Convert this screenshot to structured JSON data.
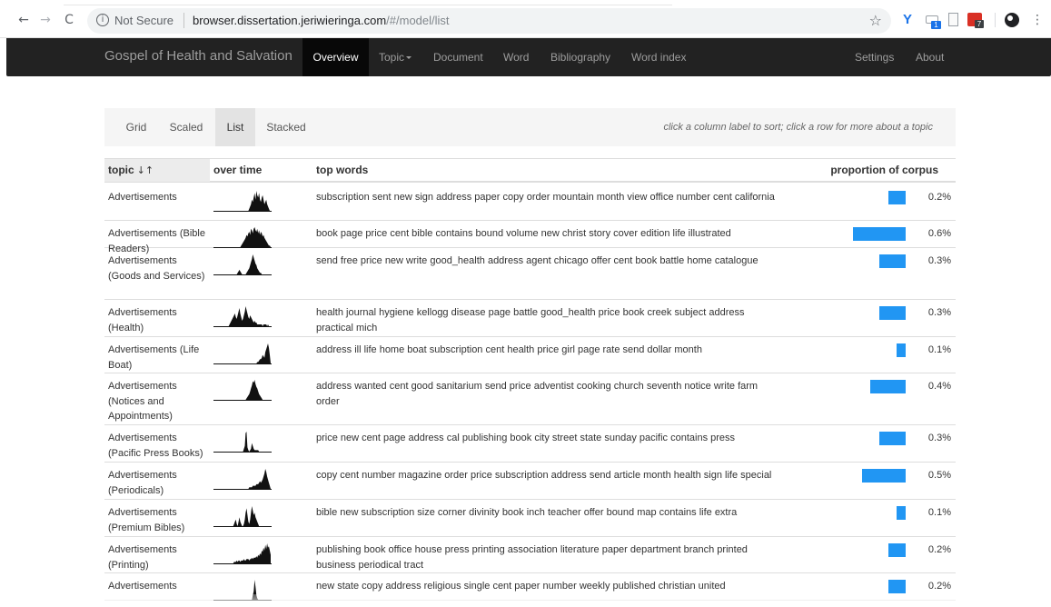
{
  "browser": {
    "back": "←",
    "forward": "→",
    "reload": "C",
    "security": "Not Secure",
    "url_host": "browser.dissertation.jeriwieringa.com",
    "url_path": "/#/model/list",
    "bookmark": "☆",
    "ext_tab_badge": "1",
    "ext_red_badge": "7",
    "menu": "⋮"
  },
  "nav": {
    "brand": "Gospel of Health and Salvation",
    "items": [
      "Overview",
      "Topic",
      "Document",
      "Word",
      "Bibliography",
      "Word index"
    ],
    "right": [
      "Settings",
      "About"
    ]
  },
  "subnav": {
    "pills": [
      "Grid",
      "Scaled",
      "List",
      "Stacked"
    ],
    "active": "List",
    "hint": "click a column label to sort; click a row for more about a topic"
  },
  "table": {
    "headers": [
      "topic",
      "over time",
      "top words",
      "proportion of corpus"
    ],
    "sort_icon": "↓↑",
    "rows": [
      {
        "topic": "Advertisements",
        "words": "subscription sent new sign address paper copy order mountain month view office number cent california",
        "pct": "0.2%",
        "prop": 0.2,
        "spark": [
          0,
          0,
          0,
          0,
          0,
          0,
          0,
          0,
          0,
          0,
          0,
          0,
          0,
          0,
          0,
          0,
          0,
          0,
          0,
          0,
          0,
          0,
          0,
          0,
          0,
          0,
          0,
          0,
          0,
          0,
          0,
          0,
          0,
          0,
          0,
          0,
          0,
          0,
          0,
          1,
          2,
          3,
          5,
          4,
          6,
          8,
          5,
          9,
          7,
          6,
          8,
          5,
          4,
          6,
          7,
          5,
          3,
          4,
          5,
          3,
          2,
          1,
          0,
          0
        ]
      },
      {
        "topic": "Advertisements (Bible Readers)",
        "words": "book page price cent bible contains bound volume new christ story cover edition life illustrated",
        "pct": "0.6%",
        "prop": 0.6,
        "spark": [
          0,
          0,
          0,
          0,
          0,
          0,
          0,
          0,
          0,
          0,
          0,
          0,
          0,
          0,
          0,
          0,
          0,
          0,
          0,
          0,
          0,
          0,
          0,
          0,
          0,
          0,
          0,
          0,
          0,
          0,
          1,
          2,
          3,
          4,
          5,
          6,
          8,
          7,
          9,
          10,
          8,
          12,
          11,
          9,
          12,
          13,
          11,
          10,
          12,
          9,
          11,
          8,
          10,
          9,
          7,
          8,
          6,
          5,
          4,
          3,
          2,
          1,
          1,
          0
        ]
      },
      {
        "topic": "Advertisements (Goods and Services)",
        "words": "send free price new write good_health address agent chicago offer cent book battle home catalogue",
        "pct": "0.3%",
        "prop": 0.3,
        "spark": [
          0,
          0,
          0,
          0,
          0,
          0,
          0,
          0,
          0,
          0,
          0,
          0,
          0,
          0,
          0,
          0,
          0,
          0,
          0,
          0,
          0,
          0,
          0,
          0,
          0,
          0,
          1,
          2,
          3,
          2,
          1,
          0,
          0,
          0,
          0,
          0,
          1,
          2,
          3,
          4,
          6,
          8,
          10,
          13,
          11,
          9,
          7,
          6,
          4,
          3,
          2,
          1,
          1,
          0,
          0,
          0,
          0,
          0,
          0,
          0,
          0,
          0,
          0,
          0
        ]
      },
      {
        "topic": "Advertisements (Health)",
        "words": "health journal hygiene kellogg disease page battle good_health price book creek subject address practical mich",
        "pct": "0.3%",
        "prop": 0.3,
        "spark": [
          0,
          0,
          0,
          0,
          0,
          0,
          0,
          0,
          0,
          0,
          0,
          0,
          0,
          0,
          0,
          0,
          0,
          1,
          2,
          3,
          4,
          5,
          6,
          7,
          5,
          4,
          6,
          8,
          10,
          7,
          5,
          3,
          4,
          6,
          8,
          11,
          9,
          7,
          5,
          4,
          6,
          5,
          4,
          3,
          2,
          3,
          2,
          2,
          1,
          1,
          1,
          1,
          1,
          1,
          0,
          1,
          1,
          1,
          1,
          0,
          1,
          0,
          0,
          0
        ]
      },
      {
        "topic": "Advertisements (Life Boat)",
        "words": "address ill life home boat subscription cent health price girl page rate send dollar month",
        "pct": "0.1%",
        "prop": 0.1,
        "spark": [
          0,
          0,
          0,
          0,
          0,
          0,
          0,
          0,
          0,
          0,
          0,
          0,
          0,
          0,
          0,
          0,
          0,
          0,
          0,
          0,
          0,
          0,
          0,
          0,
          0,
          0,
          0,
          0,
          0,
          0,
          0,
          0,
          0,
          0,
          0,
          0,
          0,
          0,
          0,
          0,
          0,
          0,
          0,
          0,
          0,
          0,
          0,
          0,
          1,
          1,
          2,
          3,
          3,
          4,
          6,
          5,
          4,
          8,
          10,
          12,
          14,
          11,
          6,
          0
        ]
      },
      {
        "topic": "Advertisements (Notices and Appointments)",
        "words": "address wanted cent good sanitarium send price adventist cooking church seventh notice write farm order",
        "pct": "0.4%",
        "prop": 0.4,
        "spark": [
          0,
          0,
          0,
          0,
          0,
          0,
          0,
          0,
          0,
          0,
          0,
          0,
          0,
          0,
          0,
          0,
          0,
          0,
          0,
          0,
          0,
          0,
          0,
          0,
          0,
          0,
          0,
          0,
          0,
          0,
          0,
          0,
          0,
          0,
          0,
          0,
          1,
          2,
          3,
          4,
          6,
          8,
          10,
          13,
          12,
          14,
          11,
          9,
          8,
          6,
          4,
          3,
          2,
          1,
          0,
          0,
          0,
          0,
          0,
          0,
          0,
          0,
          0,
          0
        ]
      },
      {
        "topic": "Advertisements (Pacific Press Books)",
        "words": "price new cent page address cal publishing book city street state sunday pacific contains press",
        "pct": "0.3%",
        "prop": 0.3,
        "spark": [
          0,
          0,
          0,
          0,
          0,
          0,
          0,
          0,
          0,
          0,
          0,
          0,
          0,
          0,
          0,
          0,
          0,
          0,
          0,
          0,
          0,
          0,
          0,
          0,
          0,
          0,
          0,
          0,
          0,
          0,
          0,
          0,
          0,
          2,
          4,
          13,
          14,
          3,
          1,
          0,
          1,
          2,
          6,
          4,
          2,
          1,
          1,
          1,
          1,
          1,
          0,
          0,
          0,
          0,
          0,
          0,
          0,
          0,
          0,
          0,
          0,
          0,
          0,
          0
        ]
      },
      {
        "topic": "Advertisements (Periodicals)",
        "words": "copy cent number magazine order price subscription address send article month health sign life special",
        "pct": "0.5%",
        "prop": 0.5,
        "spark": [
          0,
          0,
          0,
          0,
          0,
          0,
          0,
          0,
          0,
          0,
          0,
          0,
          0,
          0,
          0,
          0,
          0,
          0,
          0,
          0,
          0,
          0,
          0,
          0,
          0,
          0,
          0,
          0,
          0,
          0,
          0,
          0,
          0,
          0,
          0,
          0,
          0,
          0,
          0,
          1,
          1,
          1,
          1,
          2,
          2,
          2,
          2,
          3,
          3,
          3,
          4,
          5,
          4,
          5,
          6,
          8,
          10,
          13,
          11,
          8,
          6,
          4,
          2,
          0
        ]
      },
      {
        "topic": "Advertisements (Premium Bibles)",
        "words": "bible new subscription size corner divinity book inch teacher offer bound map contains life extra",
        "pct": "0.1%",
        "prop": 0.1,
        "spark": [
          0,
          0,
          0,
          0,
          0,
          0,
          0,
          0,
          0,
          0,
          0,
          0,
          0,
          0,
          0,
          0,
          0,
          0,
          0,
          0,
          0,
          0,
          1,
          2,
          3,
          1,
          0,
          2,
          4,
          2,
          1,
          0,
          0,
          1,
          3,
          6,
          8,
          5,
          2,
          1,
          3,
          6,
          9,
          7,
          5,
          6,
          4,
          3,
          2,
          1,
          0,
          0,
          0,
          0,
          0,
          0,
          0,
          0,
          0,
          0,
          0,
          0,
          0,
          0
        ]
      },
      {
        "topic": "Advertisements (Printing)",
        "words": "publishing book office house press printing association literature paper department branch printed business periodical tract",
        "pct": "0.2%",
        "prop": 0.2,
        "spark": [
          0,
          0,
          0,
          0,
          0,
          0,
          0,
          0,
          0,
          0,
          0,
          0,
          0,
          0,
          0,
          0,
          0,
          0,
          0,
          0,
          0,
          0,
          1,
          1,
          1,
          2,
          1,
          2,
          2,
          1,
          2,
          2,
          2,
          3,
          2,
          2,
          3,
          3,
          3,
          2,
          3,
          3,
          4,
          3,
          4,
          4,
          4,
          5,
          4,
          6,
          5,
          7,
          6,
          9,
          8,
          11,
          9,
          13,
          10,
          14,
          11,
          12,
          9,
          6
        ]
      },
      {
        "topic": "Advertisements",
        "words": "new state copy address religious single cent paper number weekly published christian united",
        "pct": "0.2%",
        "prop": 0.2,
        "spark": [
          0,
          0,
          0,
          0,
          0,
          0,
          0,
          0,
          0,
          0,
          0,
          0,
          0,
          0,
          0,
          0,
          0,
          0,
          0,
          0,
          0,
          0,
          0,
          0,
          0,
          0,
          0,
          0,
          0,
          0,
          0,
          0,
          0,
          0,
          0,
          0,
          0,
          0,
          0,
          0,
          0,
          0,
          0,
          3,
          6,
          14,
          9,
          3,
          1,
          0,
          0,
          0,
          0,
          0,
          0,
          0,
          0,
          0,
          0,
          0,
          0,
          0,
          0,
          0
        ]
      }
    ]
  },
  "colors": {
    "bar": "#2196f3",
    "navbar": "#222222",
    "navbar_active": "#080808"
  }
}
